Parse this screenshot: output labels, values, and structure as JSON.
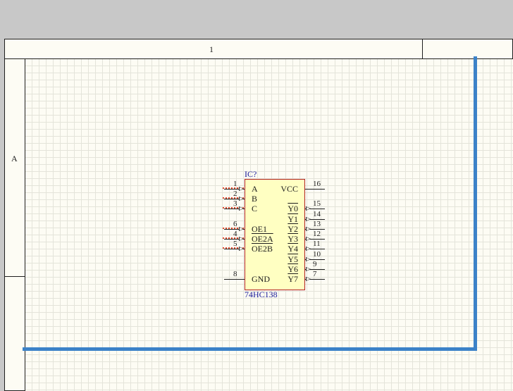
{
  "sheet": {
    "column_label": "1",
    "row_label": "A"
  },
  "wire_color": "#3c82c8",
  "component": {
    "designator": "IC?",
    "comment": "74HC138",
    "left_pins": [
      {
        "num": "1",
        "name": "A",
        "overbar": false
      },
      {
        "num": "2",
        "name": "B",
        "overbar": false
      },
      {
        "num": "3",
        "name": "C",
        "overbar": false
      },
      {
        "num": "6",
        "name": "OE1",
        "overbar": false
      },
      {
        "num": "4",
        "name": "OE2A",
        "overbar": true
      },
      {
        "num": "5",
        "name": "OE2B",
        "overbar": true
      },
      {
        "num": "8",
        "name": "GND",
        "overbar": false
      }
    ],
    "right_pins": [
      {
        "num": "16",
        "name": "VCC",
        "overbar": false
      },
      {
        "num": "15",
        "name": "Y0",
        "overbar": true
      },
      {
        "num": "14",
        "name": "Y1",
        "overbar": true
      },
      {
        "num": "13",
        "name": "Y2",
        "overbar": true
      },
      {
        "num": "12",
        "name": "Y3",
        "overbar": true
      },
      {
        "num": "11",
        "name": "Y4",
        "overbar": true
      },
      {
        "num": "10",
        "name": "Y5",
        "overbar": true
      },
      {
        "num": "9",
        "name": "Y6",
        "overbar": true
      },
      {
        "num": "7",
        "name": "Y7",
        "overbar": true
      }
    ]
  }
}
